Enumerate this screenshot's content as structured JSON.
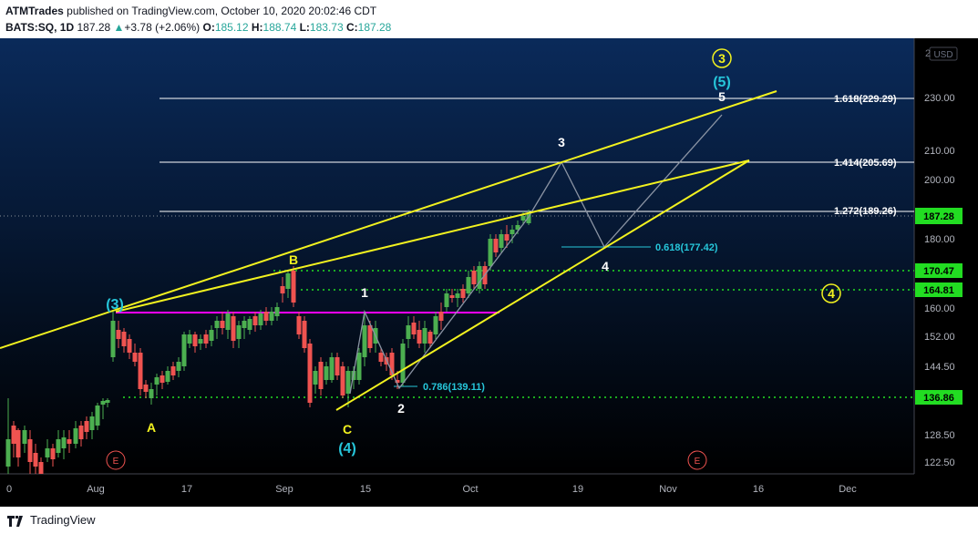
{
  "header": {
    "author": "ATMTrades",
    "published_text": "published on TradingView.com, October 10, 2020 20:02:46 CDT",
    "symbol": "BATS:SQ, 1D",
    "last": "187.28",
    "change": "+3.78 (+2.06%)",
    "open_label": "O:",
    "open": "185.12",
    "high_label": "H:",
    "high": "188.74",
    "low_label": "L:",
    "low": "183.73",
    "close_label": "C:",
    "close": "187.28"
  },
  "footer": {
    "brand": "TradingView"
  },
  "colors": {
    "bg_top": "#0a2a5a",
    "bg_bottom": "#000000",
    "bull": "#4caf50",
    "bear": "#ef5350",
    "channel": "#f2f21f",
    "magenta": "#ff00ff",
    "support": "#22dd22",
    "cyan": "#26c6da",
    "fib": "#ffffff",
    "projection": "#8a93a3"
  },
  "price_axis": {
    "currency": "USD",
    "ticks": [
      "230.00",
      "210.00",
      "200.00",
      "180.00",
      "160.00",
      "152.00",
      "144.50",
      "136.86",
      "128.50",
      "122.50"
    ],
    "price_tag": "187.28",
    "level_tags": [
      "170.47",
      "164.81",
      "136.86"
    ]
  },
  "time_axis": {
    "labels": [
      "0",
      "Aug",
      "17",
      "Sep",
      "15",
      "Oct",
      "19",
      "Nov",
      "16",
      "Dec"
    ]
  },
  "fib_levels": [
    {
      "label": "1.618(229.29)",
      "price": 229.29
    },
    {
      "label": "1.414(205.69)",
      "price": 205.69
    },
    {
      "label": "1.272(189.26)",
      "price": 189.26
    }
  ],
  "fib_retracements": [
    {
      "label": "0.618(177.42)",
      "price": 177.42
    },
    {
      "label": "0.786(139.11)",
      "price": 139.11
    }
  ],
  "support_levels": [
    170.47,
    164.81,
    136.86
  ],
  "wave_labels": {
    "w3_circle": "3",
    "w5_paren": "(5)",
    "w5": "5",
    "w3": "3",
    "w4": "4",
    "w1": "1",
    "w2": "2",
    "wB": "B",
    "wA": "A",
    "wC": "C",
    "w4_paren": "(4)",
    "w3_paren": "(3)",
    "w4_circle": "4"
  },
  "event_markers": [
    "E",
    "E"
  ]
}
